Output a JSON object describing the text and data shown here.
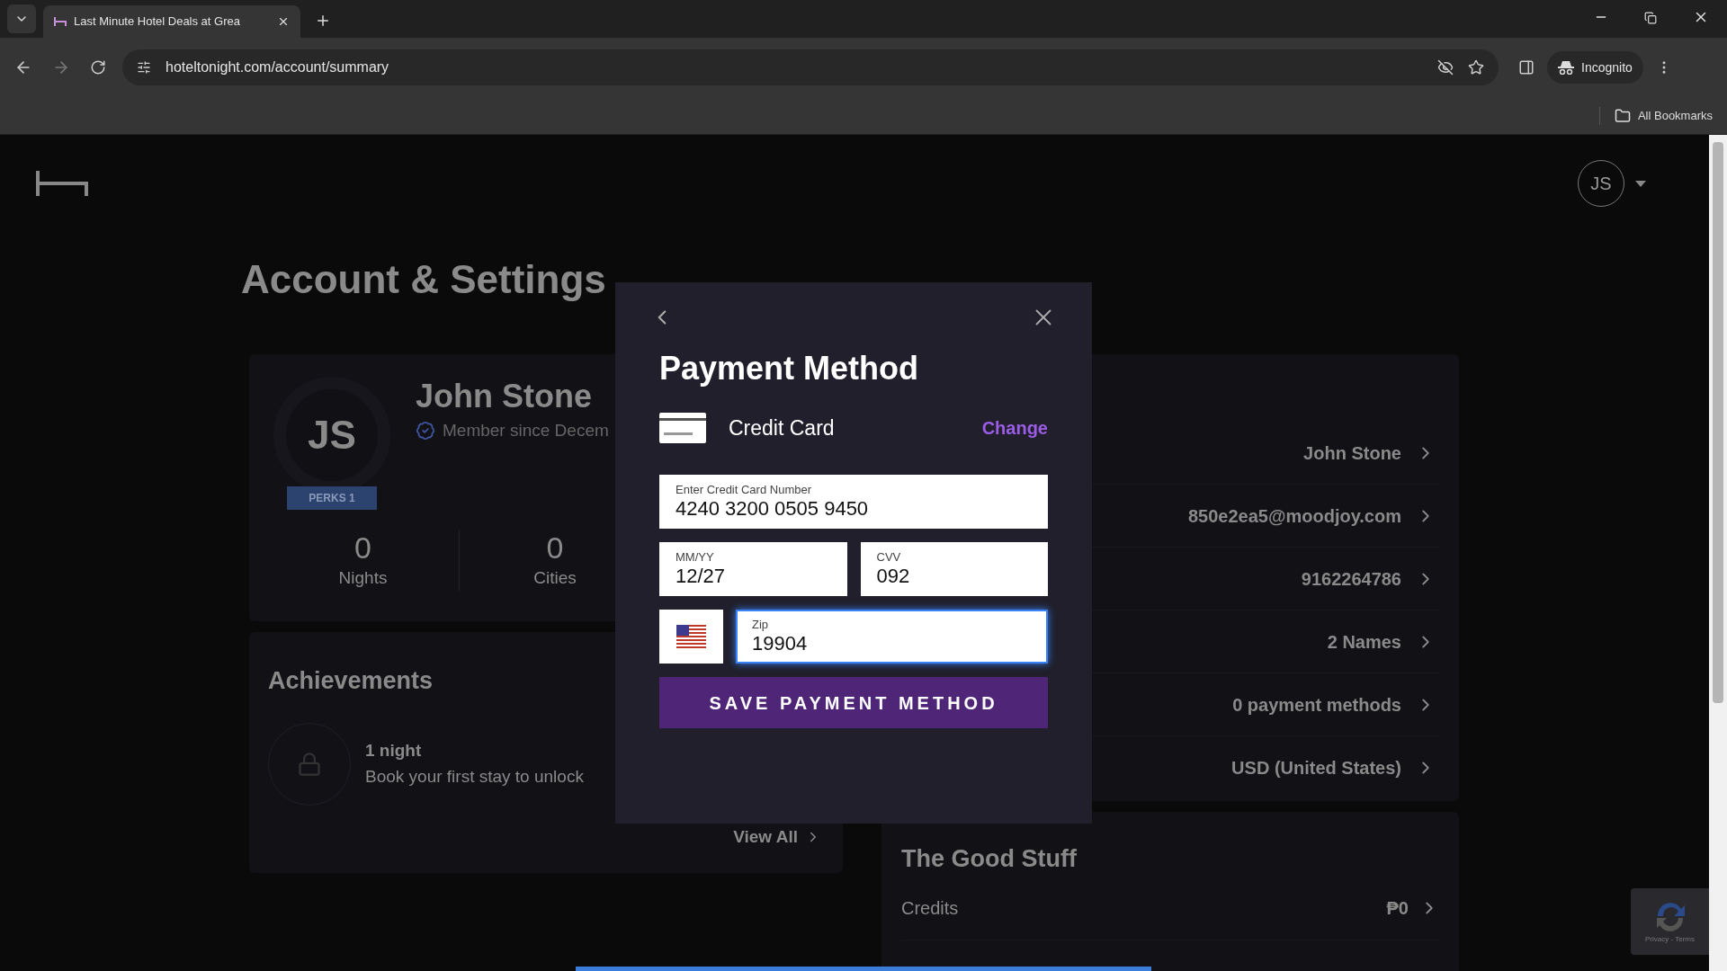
{
  "browser": {
    "tab_title": "Last Minute Hotel Deals at Grea",
    "url": "hoteltonight.com/account/summary",
    "profile_label": "Incognito",
    "bookmarks_label": "All Bookmarks"
  },
  "header": {
    "avatar_initials": "JS"
  },
  "page": {
    "title": "Account & Settings",
    "profile": {
      "initials": "JS",
      "badge": "PERKS 1",
      "name": "John Stone",
      "member_since": "Member since Decem",
      "stats": [
        {
          "value": "0",
          "label": "Nights"
        },
        {
          "value": "0",
          "label": "Cities"
        }
      ]
    },
    "achievements": {
      "title": "Achievements",
      "items": [
        {
          "title": "1 night",
          "description": "Book your first stay to unlock"
        }
      ],
      "view_all": "View All"
    },
    "account_rows": [
      {
        "value": "John Stone"
      },
      {
        "value": "850e2ea5@moodjoy.com"
      },
      {
        "value": "9162264786"
      },
      {
        "value": "2 Names"
      },
      {
        "value": "0 payment methods"
      },
      {
        "value": "USD (United States)"
      }
    ],
    "good_stuff": {
      "title": "The Good Stuff",
      "rows": [
        {
          "label": "Credits",
          "value": "₱0"
        }
      ]
    }
  },
  "modal": {
    "title": "Payment Method",
    "method": "Credit Card",
    "change": "Change",
    "fields": [
      {
        "label": "Enter Credit Card Number",
        "value": "4240 3200 0505 9450",
        "focused": false
      },
      {
        "label": "MM/YY",
        "value": "12/27",
        "focused": false
      },
      {
        "label": "CVV",
        "value": "092",
        "focused": false
      },
      {
        "label": "Zip",
        "value": "19904",
        "focused": true
      }
    ],
    "button": "SAVE PAYMENT METHOD"
  },
  "recaptcha": {
    "links": "Privacy - Terms"
  }
}
